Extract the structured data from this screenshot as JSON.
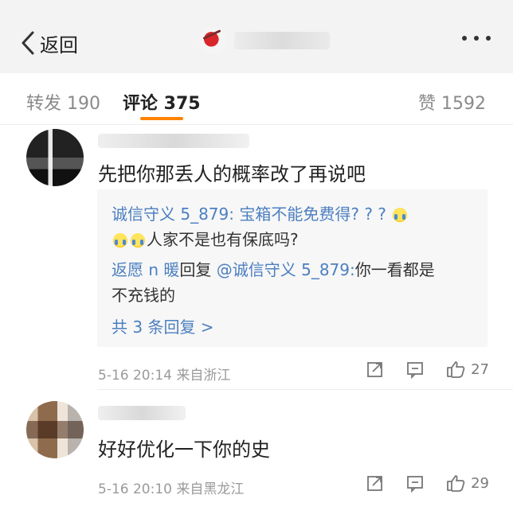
{
  "header": {
    "back_label": "返回"
  },
  "tabs": [
    {
      "label": "转发 190"
    },
    {
      "label": "评论 375"
    },
    {
      "label": "赞 1592"
    }
  ],
  "comments": [
    {
      "text": "先把你那丢人的概率改了再说吧",
      "reply_preview": {
        "line1_prefix": "诚信守义 5_879: 宝箱不能免费得? ? ? ",
        "line2_suffix": "人家不是也有保底吗?",
        "reply_author": "返愿 n 暖",
        "reply_mid": "回复",
        "reply_target": "@诚信守义 5_879:",
        "reply_text_a": "你一看都是",
        "reply_text_b": "不充钱的",
        "more_link": "共 3 条回复 >"
      },
      "meta": "5-16 20:14  来自浙江",
      "likes": "27"
    },
    {
      "text": "好好优化一下你的史",
      "meta": "5-16 20:10  来自黑龙江",
      "likes": "29"
    }
  ],
  "colors": {
    "accent": "#ff8200",
    "link": "#4c7fc0"
  }
}
